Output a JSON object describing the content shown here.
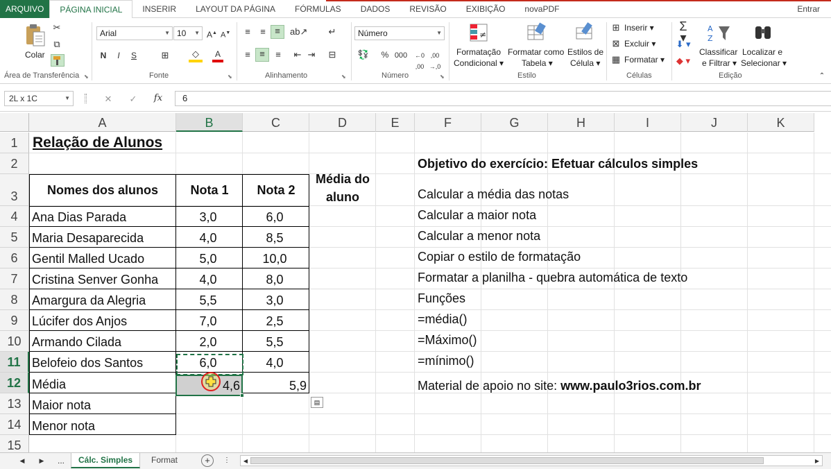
{
  "tabs": {
    "file": "ARQUIVO",
    "items": [
      "PÁGINA INICIAL",
      "INSERIR",
      "LAYOUT DA PÁGINA",
      "FÓRMULAS",
      "DADOS",
      "REVISÃO",
      "EXIBIÇÃO",
      "novaPDF"
    ],
    "signin": "Entrar"
  },
  "ribbon": {
    "clipboard": {
      "paste": "Colar",
      "label": "Área de Transferência"
    },
    "font": {
      "name": "Arial",
      "size": "10",
      "bold": "N",
      "italic": "I",
      "underline": "S",
      "label": "Fonte"
    },
    "alignment": {
      "label": "Alinhamento"
    },
    "number": {
      "format": "Número",
      "percent": "%",
      "comma": "000",
      "label": "Número"
    },
    "styles": {
      "cond1": "Formatação",
      "cond2": "Condicional",
      "table1": "Formatar como",
      "table2": "Tabela",
      "cell1": "Estilos de",
      "cell2": "Célula",
      "label": "Estilo"
    },
    "cells": {
      "insert": "Inserir",
      "delete": "Excluir",
      "format": "Formatar",
      "label": "Células"
    },
    "editing": {
      "sort1": "Classificar",
      "sort2": "e Filtrar",
      "find1": "Localizar e",
      "find2": "Selecionar",
      "label": "Edição"
    }
  },
  "formula_bar": {
    "name_box": "2L x 1C",
    "fx": "fx",
    "value": "6"
  },
  "columns": [
    "A",
    "B",
    "C",
    "D",
    "E",
    "F",
    "G",
    "H",
    "I",
    "J",
    "K"
  ],
  "rows": [
    "1",
    "2",
    "3",
    "4",
    "5",
    "6",
    "7",
    "8",
    "9",
    "10",
    "11",
    "12",
    "13",
    "14",
    "15"
  ],
  "sheet": {
    "title": "Relação de Alunos",
    "headers": {
      "name": "Nomes dos alunos",
      "n1": "Nota 1",
      "n2": "Nota 2",
      "avg1": "Média do",
      "avg2": "aluno"
    },
    "students": [
      {
        "name": "Ana Dias Parada",
        "n1": "3,0",
        "n2": "6,0"
      },
      {
        "name": "Maria Desaparecida",
        "n1": "4,0",
        "n2": "8,5"
      },
      {
        "name": "Gentil Malled Ucado",
        "n1": "5,0",
        "n2": "10,0"
      },
      {
        "name": "Cristina Senver Gonha",
        "n1": "4,0",
        "n2": "8,0"
      },
      {
        "name": "Amargura da Alegria",
        "n1": "5,5",
        "n2": "3,0"
      },
      {
        "name": "Lúcifer dos Anjos",
        "n1": "7,0",
        "n2": "2,5"
      },
      {
        "name": "Armando Cilada",
        "n1": "2,0",
        "n2": "5,5"
      },
      {
        "name": "Belofeio dos Santos",
        "n1": "6,0",
        "n2": "4,0"
      }
    ],
    "media_label": "Média",
    "media_b": "4,6",
    "media_c": "5,9",
    "maior": "Maior nota",
    "menor": "Menor nota",
    "notes": {
      "objective": "Objetivo do exercício:  Efetuar cálculos simples",
      "lines": [
        "Calcular a média das notas",
        "Calcular a maior nota",
        "Calcular a menor nota",
        "Copiar o estilo de formatação",
        "Formatar a planilha - quebra automática de texto",
        "Funções",
        "=média()",
        "=Máximo()",
        "=mínimo()"
      ],
      "site_prefix": "Material de apoio no site: ",
      "site": "www.paulo3rios.com.br"
    }
  },
  "sheet_tabs": [
    "Cálc. Simples",
    "Format"
  ],
  "sheet_nav_more": "..."
}
